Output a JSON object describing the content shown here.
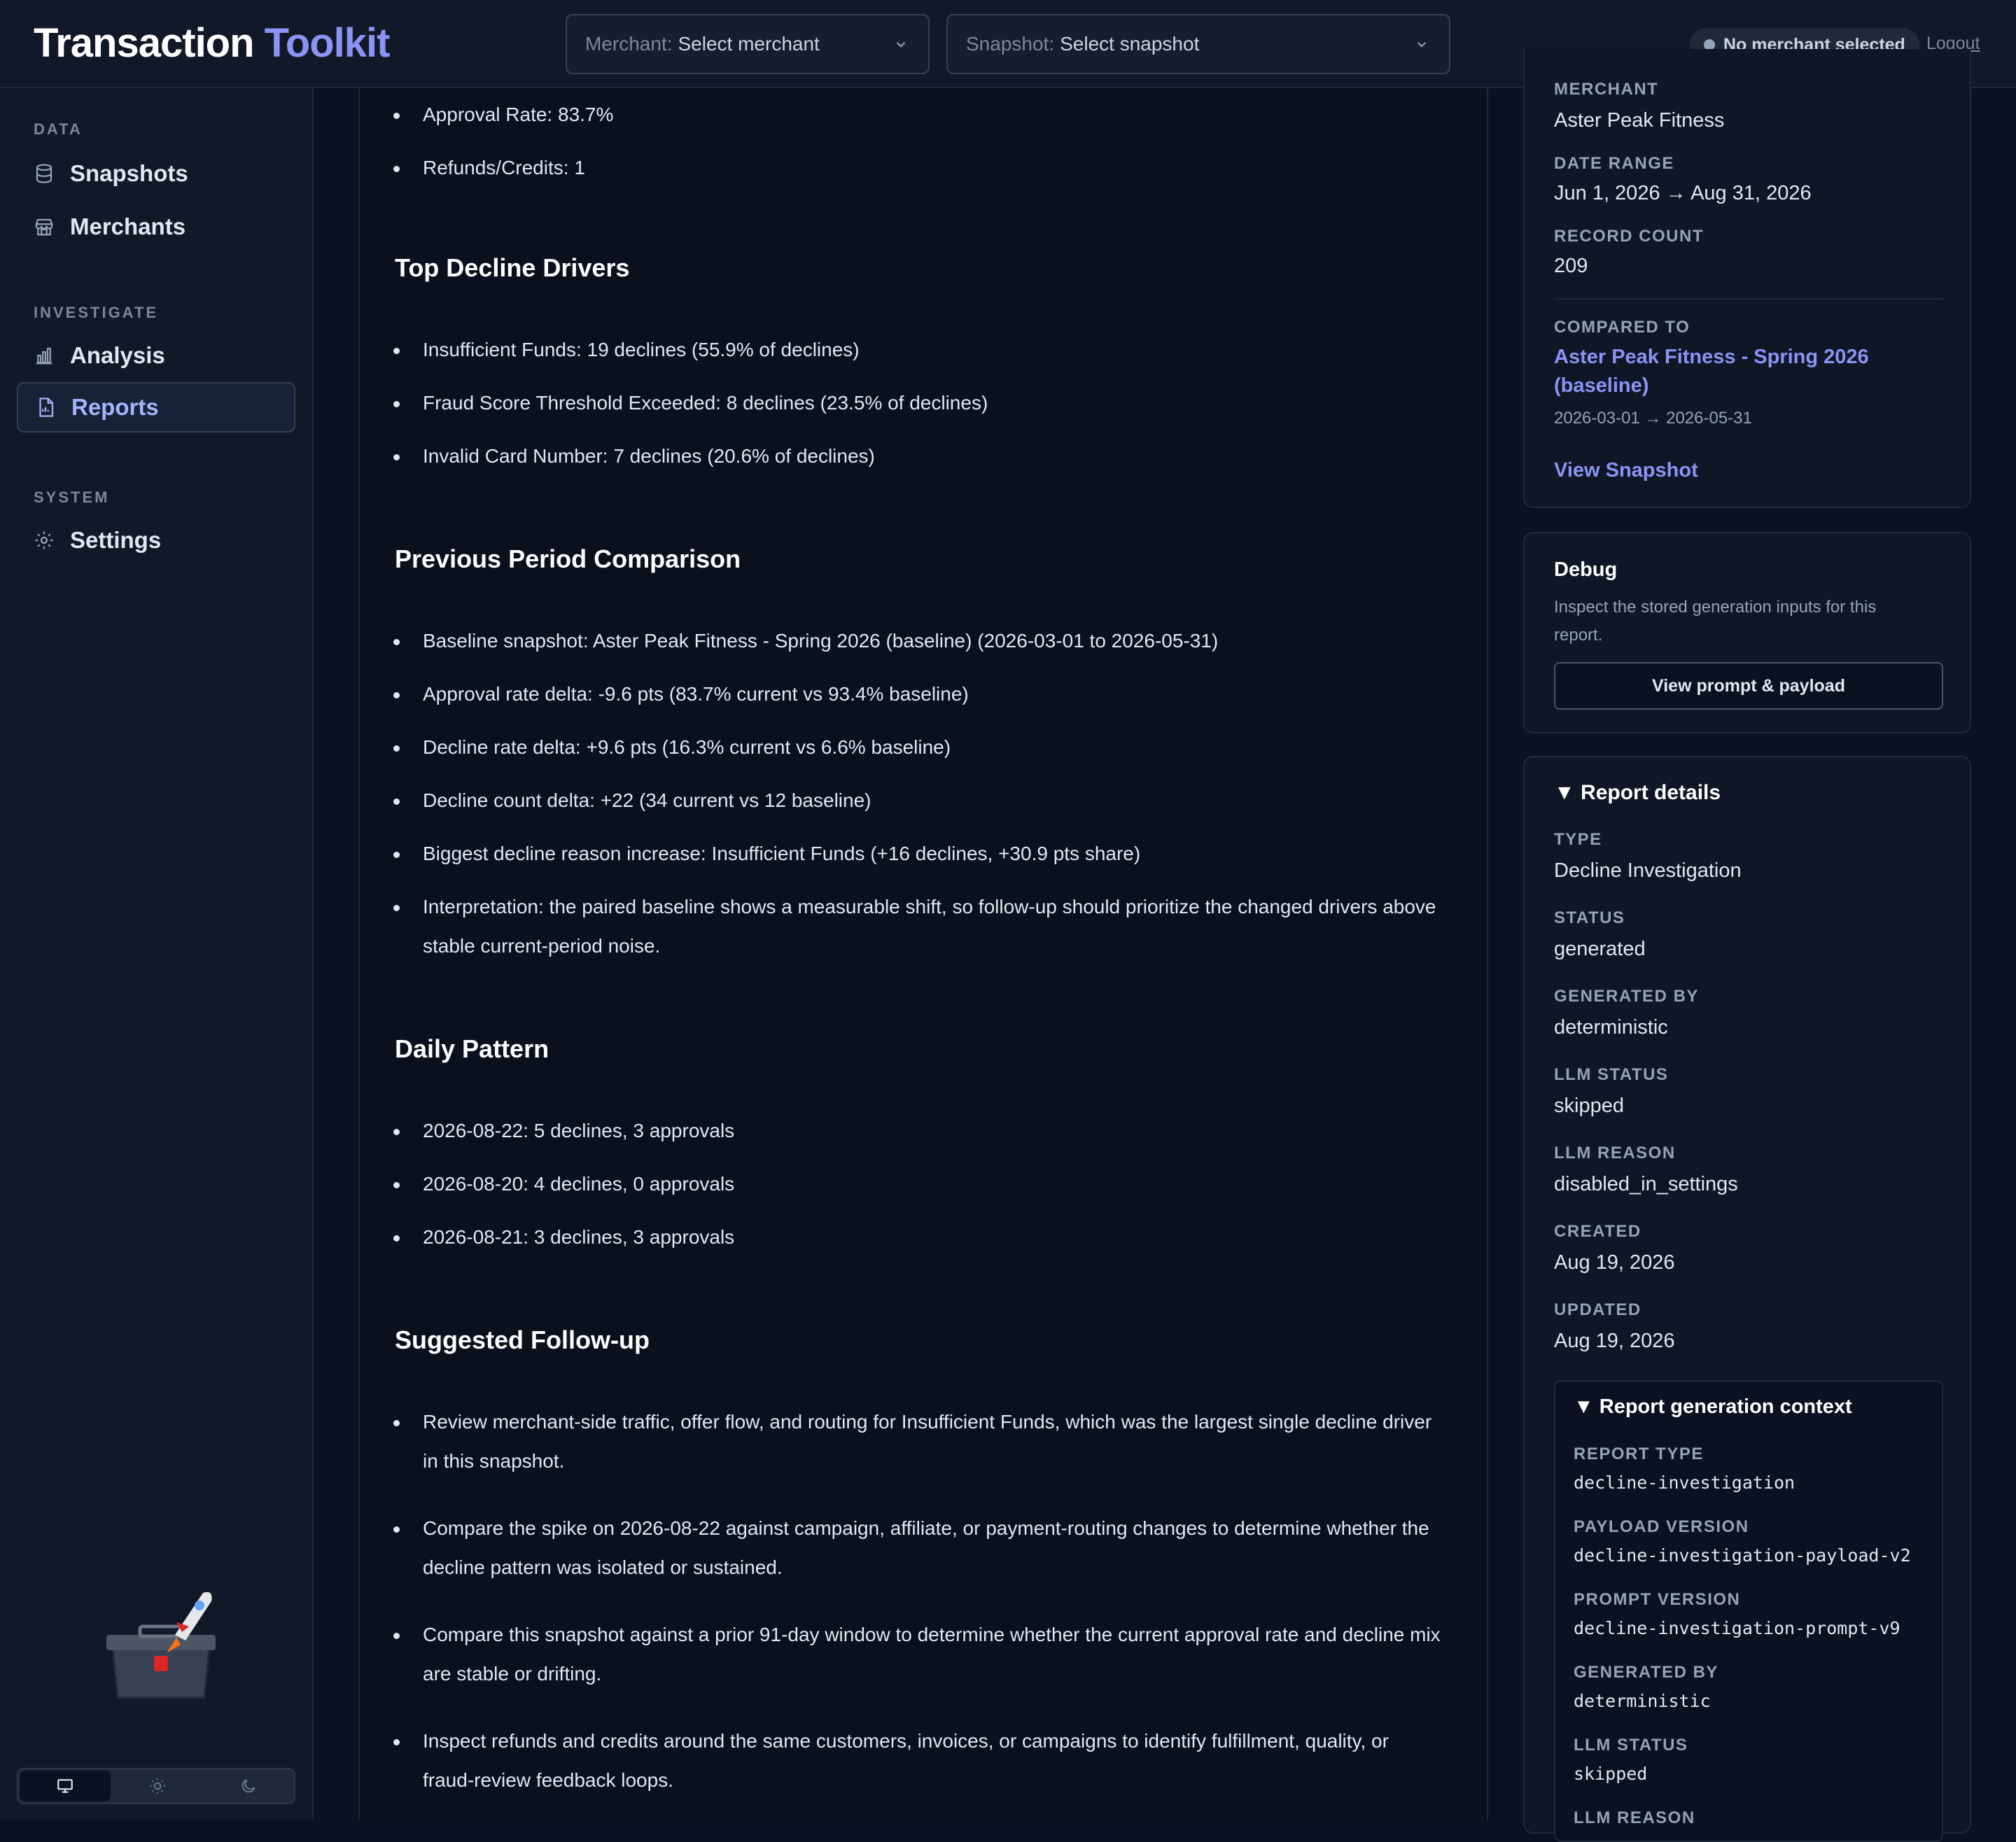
{
  "header": {
    "brand_main": "Transaction",
    "brand_accent": "Toolkit",
    "merchant_label": "Merchant:",
    "merchant_value": "Select merchant",
    "snapshot_label": "Snapshot:",
    "snapshot_value": "Select snapshot",
    "status": "No merchant selected",
    "logout": "Logout"
  },
  "sidebar": {
    "sections": [
      {
        "label": "DATA",
        "items": [
          {
            "label": "Snapshots",
            "icon": "database-icon"
          },
          {
            "label": "Merchants",
            "icon": "store-icon"
          }
        ]
      },
      {
        "label": "INVESTIGATE",
        "items": [
          {
            "label": "Analysis",
            "icon": "bar-chart-icon"
          },
          {
            "label": "Reports",
            "icon": "document-icon",
            "active": true
          }
        ]
      },
      {
        "label": "SYSTEM",
        "items": [
          {
            "label": "Settings",
            "icon": "gear-icon"
          }
        ]
      }
    ],
    "theme_modes": [
      "monitor-icon",
      "sun-icon",
      "moon-icon"
    ],
    "active_theme": "monitor-icon"
  },
  "report": {
    "summary_items": [
      "Approval Rate: 83.7%",
      "Refunds/Credits: 1"
    ],
    "top_decline": {
      "title": "Top Decline Drivers",
      "items": [
        "Insufficient Funds: 19 declines (55.9% of declines)",
        "Fraud Score Threshold Exceeded: 8 declines (23.5% of declines)",
        "Invalid Card Number: 7 declines (20.6% of declines)"
      ]
    },
    "previous": {
      "title": "Previous Period Comparison",
      "items": [
        "Baseline snapshot: Aster Peak Fitness - Spring 2026 (baseline) (2026-03-01 to 2026-05-31)",
        "Approval rate delta: -9.6 pts (83.7% current vs 93.4% baseline)",
        "Decline rate delta: +9.6 pts (16.3% current vs 6.6% baseline)",
        "Decline count delta: +22 (34 current vs 12 baseline)",
        "Biggest decline reason increase: Insufficient Funds (+16 declines, +30.9 pts share)",
        "Interpretation: the paired baseline shows a measurable shift, so follow-up should prioritize the changed drivers above stable current-period noise."
      ]
    },
    "daily": {
      "title": "Daily Pattern",
      "items": [
        "2026-08-22: 5 declines, 3 approvals",
        "2026-08-20: 4 declines, 0 approvals",
        "2026-08-21: 3 declines, 3 approvals"
      ]
    },
    "followup": {
      "title": "Suggested Follow-up",
      "items": [
        "Review merchant-side traffic, offer flow, and routing for Insufficient Funds, which was the largest single decline driver in this snapshot.",
        "Compare the spike on 2026-08-22 against campaign, affiliate, or payment-routing changes to determine whether the decline pattern was isolated or sustained.",
        "Compare this snapshot against a prior 91-day window to determine whether the current approval rate and decline mix are stable or drifting.",
        "Inspect refunds and credits around the same customers, invoices, or campaigns to identify fulfillment, quality, or fraud-review feedback loops."
      ]
    }
  },
  "snapshot_panel": {
    "merchant_key": "MERCHANT",
    "merchant_value": "Aster Peak Fitness",
    "date_range_key": "DATE RANGE",
    "date_range_value": "Jun 1, 2026 → Aug 31, 2026",
    "record_count_key": "RECORD COUNT",
    "record_count_value": "209",
    "compared_key": "COMPARED TO",
    "compared_line1": "Aster Peak Fitness - Spring 2026",
    "compared_line2": "(baseline)",
    "compared_range": "2026-03-01 → 2026-05-31",
    "view_snapshot": "View Snapshot"
  },
  "debug": {
    "title": "Debug",
    "desc_line1": "Inspect the stored generation inputs for this",
    "desc_line2": "report.",
    "button": "View prompt & payload"
  },
  "details": {
    "title": "Report details",
    "fields": [
      {
        "k": "TYPE",
        "v": "Decline Investigation"
      },
      {
        "k": "STATUS",
        "v": "generated"
      },
      {
        "k": "GENERATED BY",
        "v": "deterministic"
      },
      {
        "k": "LLM STATUS",
        "v": "skipped"
      },
      {
        "k": "LLM REASON",
        "v": "disabled_in_settings"
      },
      {
        "k": "CREATED",
        "v": "Aug 19, 2026"
      },
      {
        "k": "UPDATED",
        "v": "Aug 19, 2026"
      }
    ],
    "context": {
      "title": "Report generation context",
      "fields": [
        {
          "k": "REPORT TYPE",
          "v": "decline-investigation"
        },
        {
          "k": "PAYLOAD VERSION",
          "v": "decline-investigation-payload-v2"
        },
        {
          "k": "PROMPT VERSION",
          "v": "decline-investigation-prompt-v9"
        },
        {
          "k": "GENERATED BY",
          "v": "deterministic"
        },
        {
          "k": "LLM STATUS",
          "v": "skipped"
        },
        {
          "k": "LLM REASON",
          "v": ""
        }
      ]
    }
  }
}
